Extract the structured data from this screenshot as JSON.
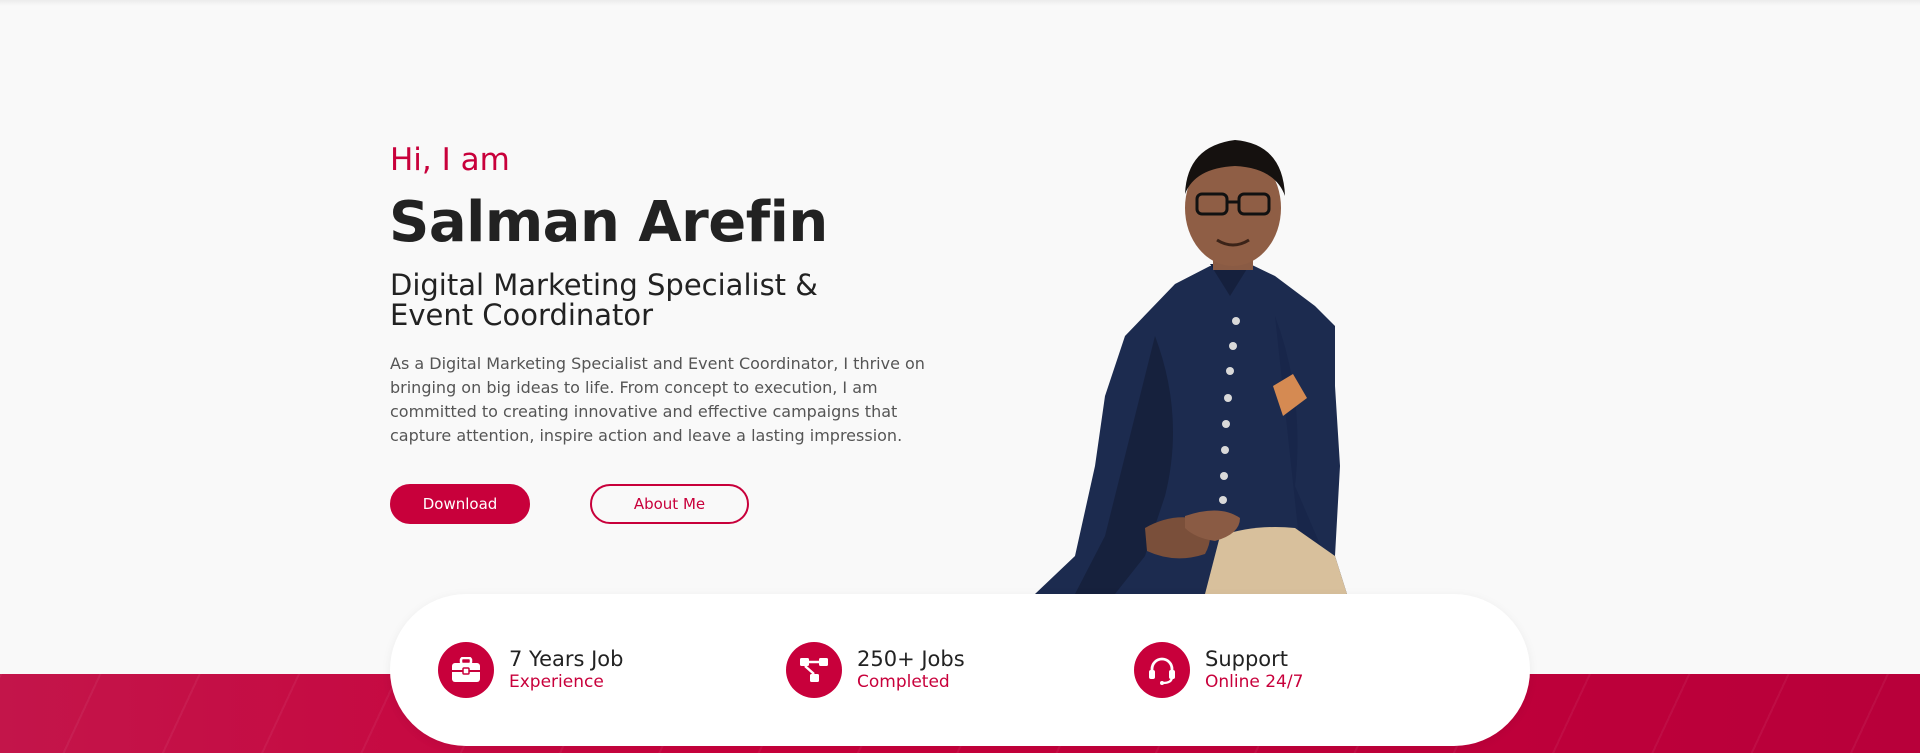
{
  "hero": {
    "greeting": "Hi, I am",
    "name": "Salman Arefin",
    "role_line1": "Digital Marketing Specialist &",
    "role_line2": "Event Coordinator",
    "bio": "As a Digital Marketing Specialist and Event Coordinator, I thrive on bringing on big ideas to life. From concept to execution, I am committed to creating innovative and effective campaigns that capture attention, inspire action and leave a lasting impression.",
    "buttons": {
      "download": "Download",
      "about": "About Me"
    }
  },
  "stats": [
    {
      "icon": "briefcase-icon",
      "title": "7 Years Job",
      "subtitle": "Experience"
    },
    {
      "icon": "workflow-icon",
      "title": "250+ Jobs",
      "subtitle": "Completed"
    },
    {
      "icon": "headset-icon",
      "title": "Support",
      "subtitle": "Online 24/7"
    }
  ],
  "colors": {
    "accent": "#c8003b",
    "heading": "#222222",
    "body_text": "#555555",
    "background": "#f9f9f9"
  }
}
